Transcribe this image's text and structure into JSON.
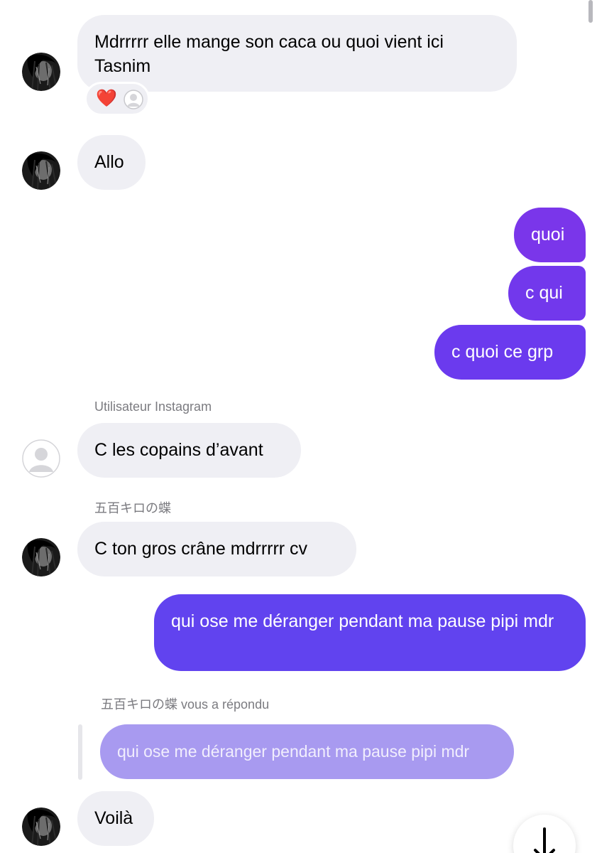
{
  "messages": {
    "m1": {
      "text": "Mdrrrrr elle mange son caca ou quoi vient ici Tasnim",
      "reaction": "❤️"
    },
    "m2": {
      "text": "Allo"
    },
    "m3": {
      "text": "quoi"
    },
    "m4": {
      "text": "c qui"
    },
    "m5": {
      "text": "c quoi ce grp"
    },
    "m6": {
      "sender": "Utilisateur Instagram",
      "text": "C les copains d’avant"
    },
    "m7": {
      "sender": "五百キロの蝶",
      "text": "C ton gros crâne mdrrrrr cv"
    },
    "m8": {
      "text": "qui ose me déranger pendant ma pause pipi mdr"
    },
    "m9": {
      "reply_label": "五百キロの蝶 vous a répondu",
      "quoted": "qui ose me déranger pendant ma pause pipi mdr",
      "text": "Voilà"
    }
  },
  "colors": {
    "incoming_bubble": "#efeff4",
    "outgoing_top": "#7a36ea",
    "outgoing_bottom": "#6143ef",
    "quoted_bubble": "#a89af0",
    "sender_label": "#7b7b80"
  },
  "icons": {
    "avatar": "dark-hair-avatar-icon",
    "default_avatar": "default-user-icon",
    "scroll": "arrow-down-icon"
  }
}
